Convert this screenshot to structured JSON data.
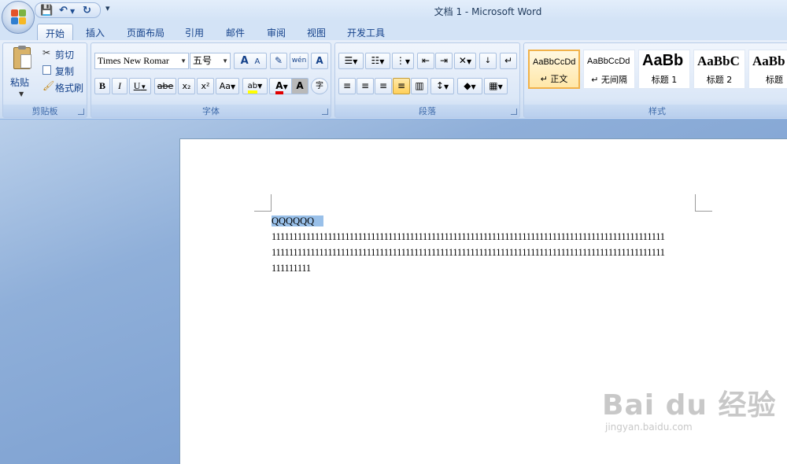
{
  "window": {
    "title": "文档 1 - Microsoft Word"
  },
  "qat": {
    "save_icon": "💾",
    "undo_icon": "↶",
    "redo_icon": "↻",
    "more_icon": "▾"
  },
  "tabs": [
    {
      "label": "开始",
      "active": true
    },
    {
      "label": "插入"
    },
    {
      "label": "页面布局"
    },
    {
      "label": "引用"
    },
    {
      "label": "邮件"
    },
    {
      "label": "审阅"
    },
    {
      "label": "视图"
    },
    {
      "label": "开发工具"
    }
  ],
  "clipboard": {
    "group_label": "剪贴板",
    "paste": "粘贴",
    "cut": "剪切",
    "copy": "复制",
    "format_painter": "格式刷"
  },
  "font": {
    "group_label": "字体",
    "font_name": "Times New Romar",
    "font_size": "五号",
    "grow": "A",
    "shrink": "A",
    "bold": "B",
    "italic": "I",
    "underline": "U",
    "strike": "abe",
    "subscript": "x₂",
    "superscript": "x²",
    "case": "Aa",
    "highlight": "ab",
    "color": "A",
    "phonetic": "wén",
    "border_char": "A",
    "shade_char": "A",
    "enclose": "字"
  },
  "paragraph": {
    "group_label": "段落"
  },
  "styles": {
    "group_label": "样式",
    "items": [
      {
        "sample": "AaBbCcDd",
        "name": "↵ 正文"
      },
      {
        "sample": "AaBbCcDd",
        "name": "↵ 无间隔"
      },
      {
        "sample": "AaBb",
        "name": "标题 1"
      },
      {
        "sample": "AaBbC",
        "name": "标题 2"
      },
      {
        "sample": "AaBb",
        "name": "标题"
      }
    ]
  },
  "document": {
    "line1": "QQQQQQ",
    "line2": "1111111111111111111111111111111111111111111111111111111111111111111111111111111111111111111",
    "line3": "1111111111111111111111111111111111111111111111111111111111111111111111111111111111111111111",
    "line4": "111111111"
  },
  "watermark": {
    "main": "Bai du 经验",
    "sub": "jingyan.baidu.com"
  }
}
